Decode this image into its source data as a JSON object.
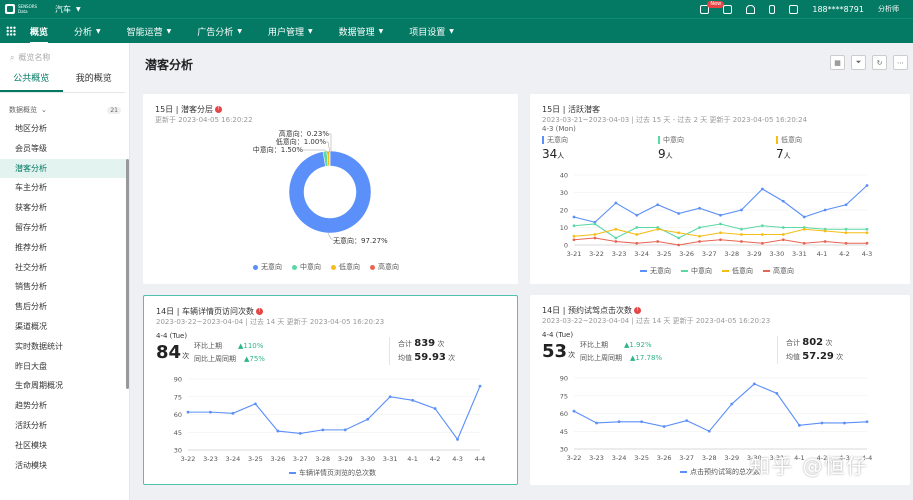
{
  "header": {
    "logo_line1": "SENSORS",
    "logo_line2": "Data",
    "project": "汽车",
    "new_badge": "New",
    "user_phone": "188****8791",
    "user_role": "分析师"
  },
  "nav": {
    "items": [
      {
        "label": "概览",
        "active": true
      },
      {
        "label": "分析"
      },
      {
        "label": "智能运营"
      },
      {
        "label": "广告分析"
      },
      {
        "label": "用户管理"
      },
      {
        "label": "数据管理"
      },
      {
        "label": "项目设置"
      }
    ]
  },
  "sidebar": {
    "search_placeholder": "概览名称",
    "tabs": [
      {
        "label": "公共概览"
      },
      {
        "label": "我的概览"
      }
    ],
    "group_label": "数据概览",
    "group_count": "21",
    "items": [
      "地区分析",
      "会员等级",
      "潜客分析",
      "车主分析",
      "获客分析",
      "留存分析",
      "推荐分析",
      "社交分析",
      "销售分析",
      "售后分析",
      "渠道概况",
      "实时数据统计",
      "昨日大盘",
      "生命周期概况",
      "趋势分析",
      "活跃分析",
      "社区模块",
      "活动模块"
    ],
    "active_index": 2
  },
  "page": {
    "title": "潜客分析"
  },
  "card1": {
    "title": "15日 | 潜客分层",
    "updated": "更新于 2023-04-05 16:20:22",
    "chart_data": {
      "type": "pie",
      "labels": [
        "无意向",
        "中意向",
        "低意向",
        "高意向"
      ],
      "values": [
        97.27,
        1.5,
        1.0,
        0.23
      ],
      "data_labels": [
        "无意向：97.27%",
        "中意向：1.50%",
        "低意向：1.00%",
        "高意向：0.23%"
      ],
      "colors": [
        "#5b8ff9",
        "#5ad8a6",
        "#f6bd16",
        "#e86452"
      ],
      "legend_position": "bottom"
    }
  },
  "card2": {
    "title": "15日 | 活跃潜客",
    "range": "2023-03-21~2023-04-03 | 过去 15 天 - 过去 2 天 更新于 2023-04-05 16:20:24",
    "date": "4-3 (Mon)",
    "stats": [
      {
        "label": "无意向",
        "value": "34",
        "unit": "人",
        "color": "#5b8ff9"
      },
      {
        "label": "中意向",
        "value": "9",
        "unit": "人",
        "color": "#5ad8a6"
      },
      {
        "label": "低意向",
        "value": "7",
        "unit": "人",
        "color": "#f6bd16"
      }
    ],
    "chart_data": {
      "type": "line",
      "x": [
        "3-21",
        "3-22",
        "3-23",
        "3-24",
        "3-25",
        "3-26",
        "3-27",
        "3-28",
        "3-29",
        "3-30",
        "3-31",
        "4-1",
        "4-2",
        "4-3"
      ],
      "ylim": [
        0,
        40
      ],
      "yticks": [
        0,
        10,
        20,
        30,
        40
      ],
      "series": [
        {
          "name": "无意向",
          "color": "#5b8ff9",
          "values": [
            16,
            13,
            24,
            17,
            23,
            18,
            21,
            17,
            20,
            32,
            25,
            16,
            20,
            23,
            34
          ]
        },
        {
          "name": "中意向",
          "color": "#5ad8a6",
          "values": [
            11,
            12,
            4,
            10,
            10,
            4,
            10,
            12,
            9,
            11,
            10,
            10,
            9,
            9,
            9
          ]
        },
        {
          "name": "低意向",
          "color": "#f6bd16",
          "values": [
            5,
            6,
            9,
            6,
            9,
            7,
            5,
            7,
            6,
            6,
            6,
            9,
            8,
            7,
            7
          ]
        },
        {
          "name": "高意向",
          "color": "#e86452",
          "values": [
            3,
            4,
            2,
            1,
            2,
            0,
            2,
            3,
            2,
            1,
            3,
            1,
            2,
            1,
            1
          ]
        }
      ],
      "legend_position": "bottom"
    }
  },
  "card3": {
    "title": "14日 | 车辆详情页访问次数",
    "range": "2023-03-22~2023-04-04 | 过去 14 天 更新于 2023-04-05 16:20:23",
    "date": "4-4 (Tue)",
    "big_value": "84",
    "big_unit": "次",
    "cmp1_label": "环比上期",
    "cmp1_value": "▲110%",
    "cmp2_label": "同比上周同期",
    "cmp2_value": "▲75%",
    "total_label": "合计",
    "total_value": "839",
    "total_unit": "次",
    "avg_label": "均值",
    "avg_value": "59.93",
    "avg_unit": "次",
    "chart_data": {
      "type": "line",
      "x": [
        "3-22",
        "3-23",
        "3-24",
        "3-25",
        "3-26",
        "3-27",
        "3-28",
        "3-29",
        "3-30",
        "3-31",
        "4-1",
        "4-2",
        "4-3",
        "4-4"
      ],
      "ylim": [
        30,
        90
      ],
      "yticks": [
        30,
        45,
        60,
        75,
        90
      ],
      "series": [
        {
          "name": "车辆详情页浏览的总次数",
          "color": "#5b8ff9",
          "values": [
            62,
            62,
            61,
            69,
            46,
            44,
            47,
            47,
            56,
            75,
            72,
            65,
            39,
            84
          ]
        }
      ],
      "legend_position": "bottom"
    }
  },
  "card4": {
    "title": "14日 | 预约试驾点击次数",
    "range": "2023-03-22~2023-04-04 | 过去 14 天 更新于 2023-04-05 16:20:23",
    "date": "4-4 (Tue)",
    "big_value": "53",
    "big_unit": "次",
    "cmp1_label": "环比上期",
    "cmp1_value": "▲1.92%",
    "cmp2_label": "同比上周同期",
    "cmp2_value": "▲17.78%",
    "total_label": "合计",
    "total_value": "802",
    "total_unit": "次",
    "avg_label": "均值",
    "avg_value": "57.29",
    "avg_unit": "次",
    "chart_data": {
      "type": "line",
      "x": [
        "3-22",
        "3-23",
        "3-24",
        "3-25",
        "3-26",
        "3-27",
        "3-28",
        "3-29",
        "3-30",
        "3-31",
        "4-1",
        "4-2",
        "4-3",
        "4-4"
      ],
      "ylim": [
        30,
        90
      ],
      "yticks": [
        30,
        45,
        60,
        75,
        90
      ],
      "series": [
        {
          "name": "点击预约试驾的总次数",
          "color": "#5b8ff9",
          "values": [
            62,
            52,
            53,
            53,
            49,
            54,
            45,
            68,
            85,
            77,
            50,
            52,
            52,
            53
          ]
        }
      ],
      "legend_position": "bottom"
    }
  },
  "watermark": "知乎 @恒仔"
}
